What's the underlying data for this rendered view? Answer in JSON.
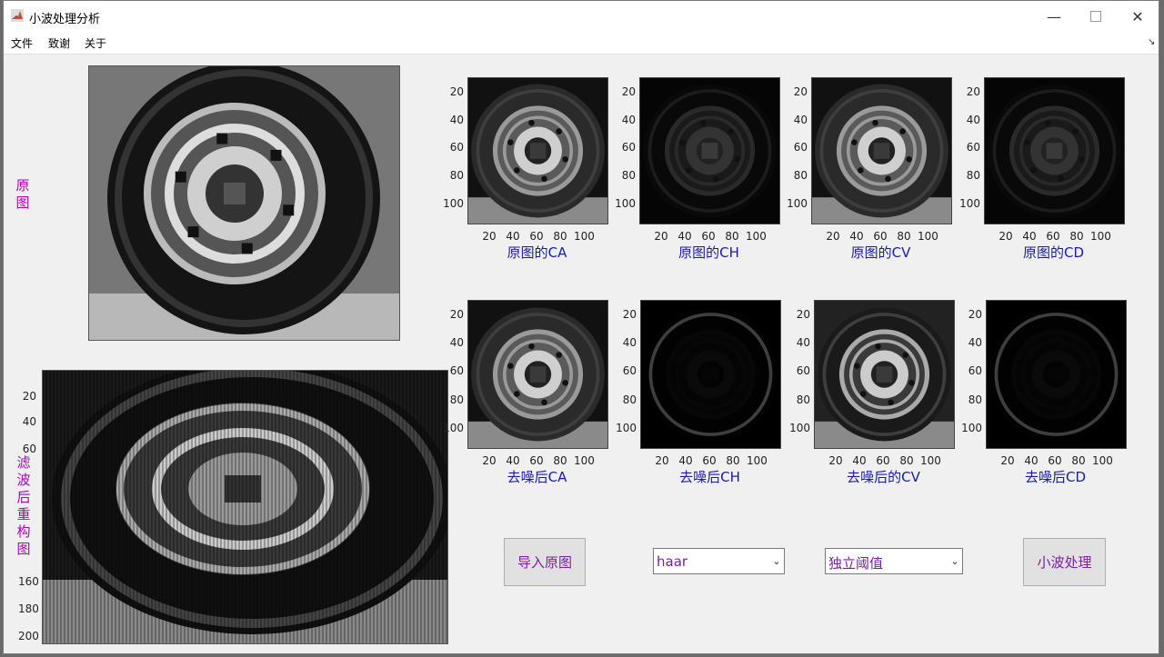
{
  "window": {
    "title": "小波处理分析"
  },
  "menu": [
    "文件",
    "致谢",
    "关于"
  ],
  "original": {
    "label": "原图"
  },
  "reconstructed": {
    "label": "滤波后重构图",
    "y_ticks": [
      "20",
      "40",
      "60",
      "160",
      "180",
      "200"
    ]
  },
  "ticks": [
    "20",
    "40",
    "60",
    "80",
    "100"
  ],
  "top_row": [
    {
      "caption": "原图的CA",
      "variant": "bright"
    },
    {
      "caption": "原图的CH",
      "variant": "dark"
    },
    {
      "caption": "原图的CV",
      "variant": "bright"
    },
    {
      "caption": "原图的CD",
      "variant": "dark"
    }
  ],
  "bottom_row": [
    {
      "caption": "去噪后CA",
      "variant": "bright"
    },
    {
      "caption": "去噪后CH",
      "variant": "black"
    },
    {
      "caption": "去噪后的CV",
      "variant": "blur"
    },
    {
      "caption": "去噪后CD",
      "variant": "black"
    }
  ],
  "controls": {
    "import_button": "导入原图",
    "wavelet_select": "haar",
    "threshold_select": "独立阈值",
    "process_button": "小波处理"
  }
}
